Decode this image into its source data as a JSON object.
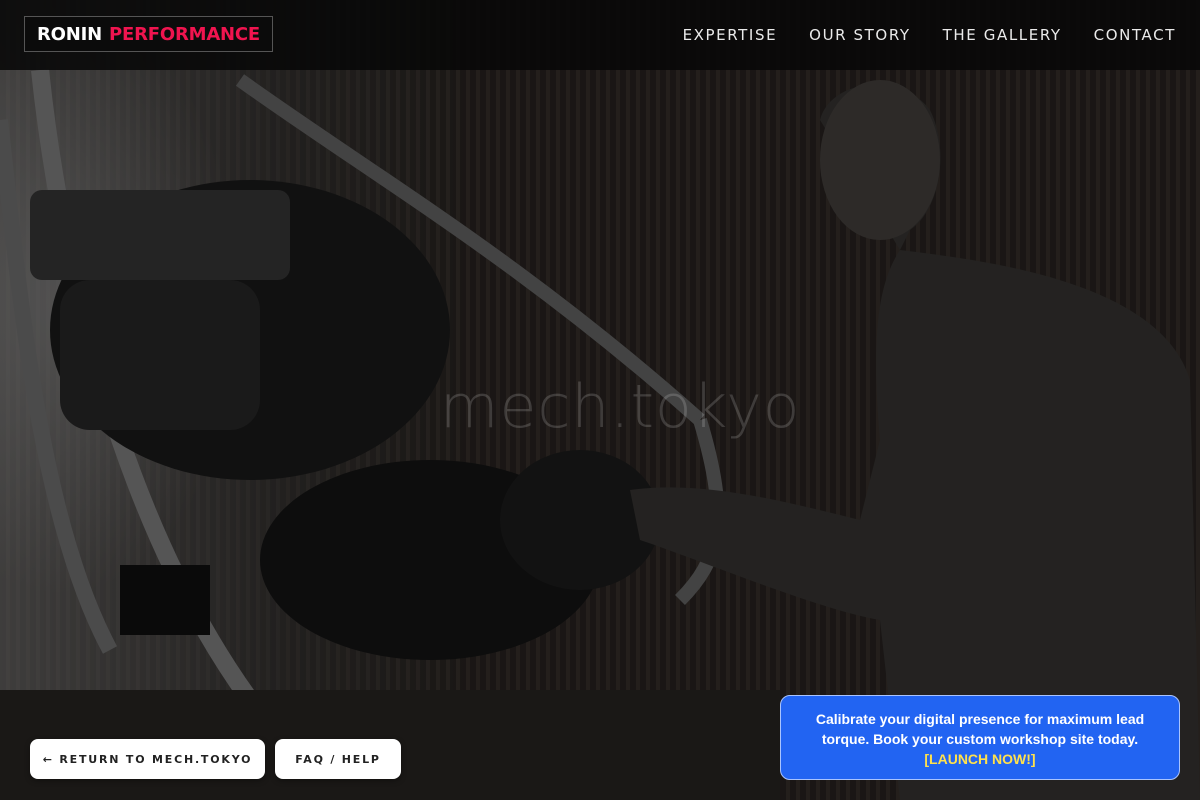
{
  "header": {
    "logo_word1": "RONIN",
    "logo_word2": "PERFORMANCE",
    "nav": [
      {
        "label": "EXPERTISE"
      },
      {
        "label": "OUR STORY"
      },
      {
        "label": "THE GALLERY"
      },
      {
        "label": "CONTACT"
      }
    ]
  },
  "hero": {
    "watermark": "mech.tokyo"
  },
  "actions": {
    "return_label": "← RETURN TO MECH.TOKYO",
    "faq_label": "FAQ / HELP"
  },
  "promo": {
    "text": "Calibrate your digital presence for maximum lead torque. Book your custom workshop site today.",
    "cta": "[LAUNCH NOW!]"
  },
  "colors": {
    "logo_accent": "#f0144f",
    "promo_bg": "#2264f2",
    "promo_cta": "#ffe14d"
  }
}
